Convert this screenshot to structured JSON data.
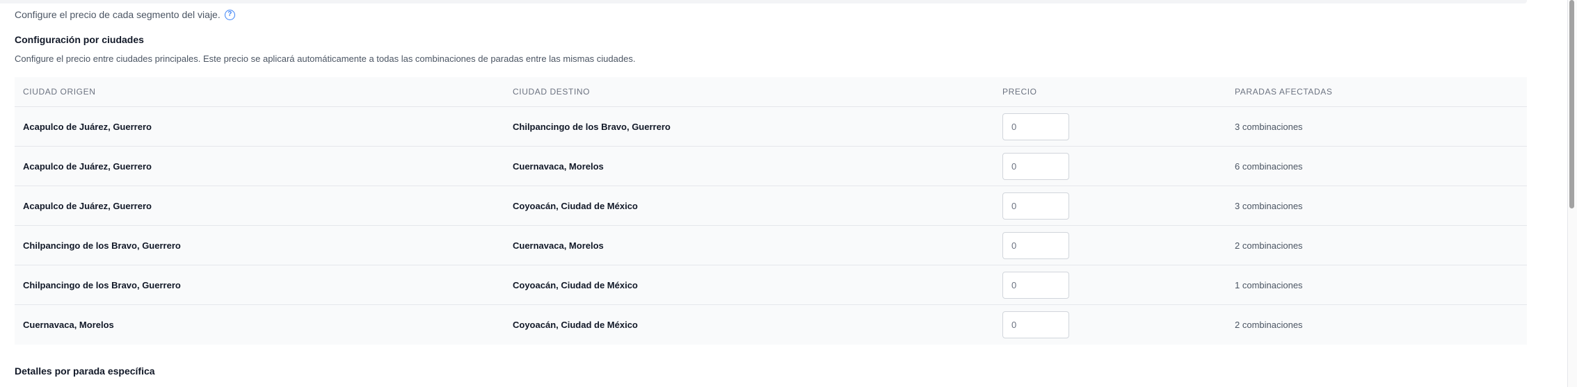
{
  "intro": {
    "text": "Configure el precio de cada segmento del viaje.",
    "help_icon": "question-circle-icon"
  },
  "section": {
    "title": "Configuración por ciudades",
    "description": "Configure el precio entre ciudades principales. Este precio se aplicará automáticamente a todas las combinaciones de paradas entre las mismas ciudades."
  },
  "table": {
    "headers": [
      "CIUDAD ORIGEN",
      "CIUDAD DESTINO",
      "PRECIO",
      "PARADAS AFECTADAS"
    ],
    "rows": [
      {
        "origin": "Acapulco de Juárez, Guerrero",
        "destination": "Chilpancingo de los Bravo, Guerrero",
        "price": "0",
        "affected": "3 combinaciones"
      },
      {
        "origin": "Acapulco de Juárez, Guerrero",
        "destination": "Cuernavaca, Morelos",
        "price": "0",
        "affected": "6 combinaciones"
      },
      {
        "origin": "Acapulco de Juárez, Guerrero",
        "destination": "Coyoacán, Ciudad de México",
        "price": "0",
        "affected": "3 combinaciones"
      },
      {
        "origin": "Chilpancingo de los Bravo, Guerrero",
        "destination": "Cuernavaca, Morelos",
        "price": "0",
        "affected": "2 combinaciones"
      },
      {
        "origin": "Chilpancingo de los Bravo, Guerrero",
        "destination": "Coyoacán, Ciudad de México",
        "price": "0",
        "affected": "1 combinaciones"
      },
      {
        "origin": "Cuernavaca, Morelos",
        "destination": "Coyoacán, Ciudad de México",
        "price": "0",
        "affected": "2 combinaciones"
      }
    ]
  },
  "next_section": {
    "title": "Detalles por parada específica"
  },
  "colors": {
    "accent": "#3b82f6",
    "table_bg": "#f9fafb",
    "border": "#e5e7eb"
  }
}
